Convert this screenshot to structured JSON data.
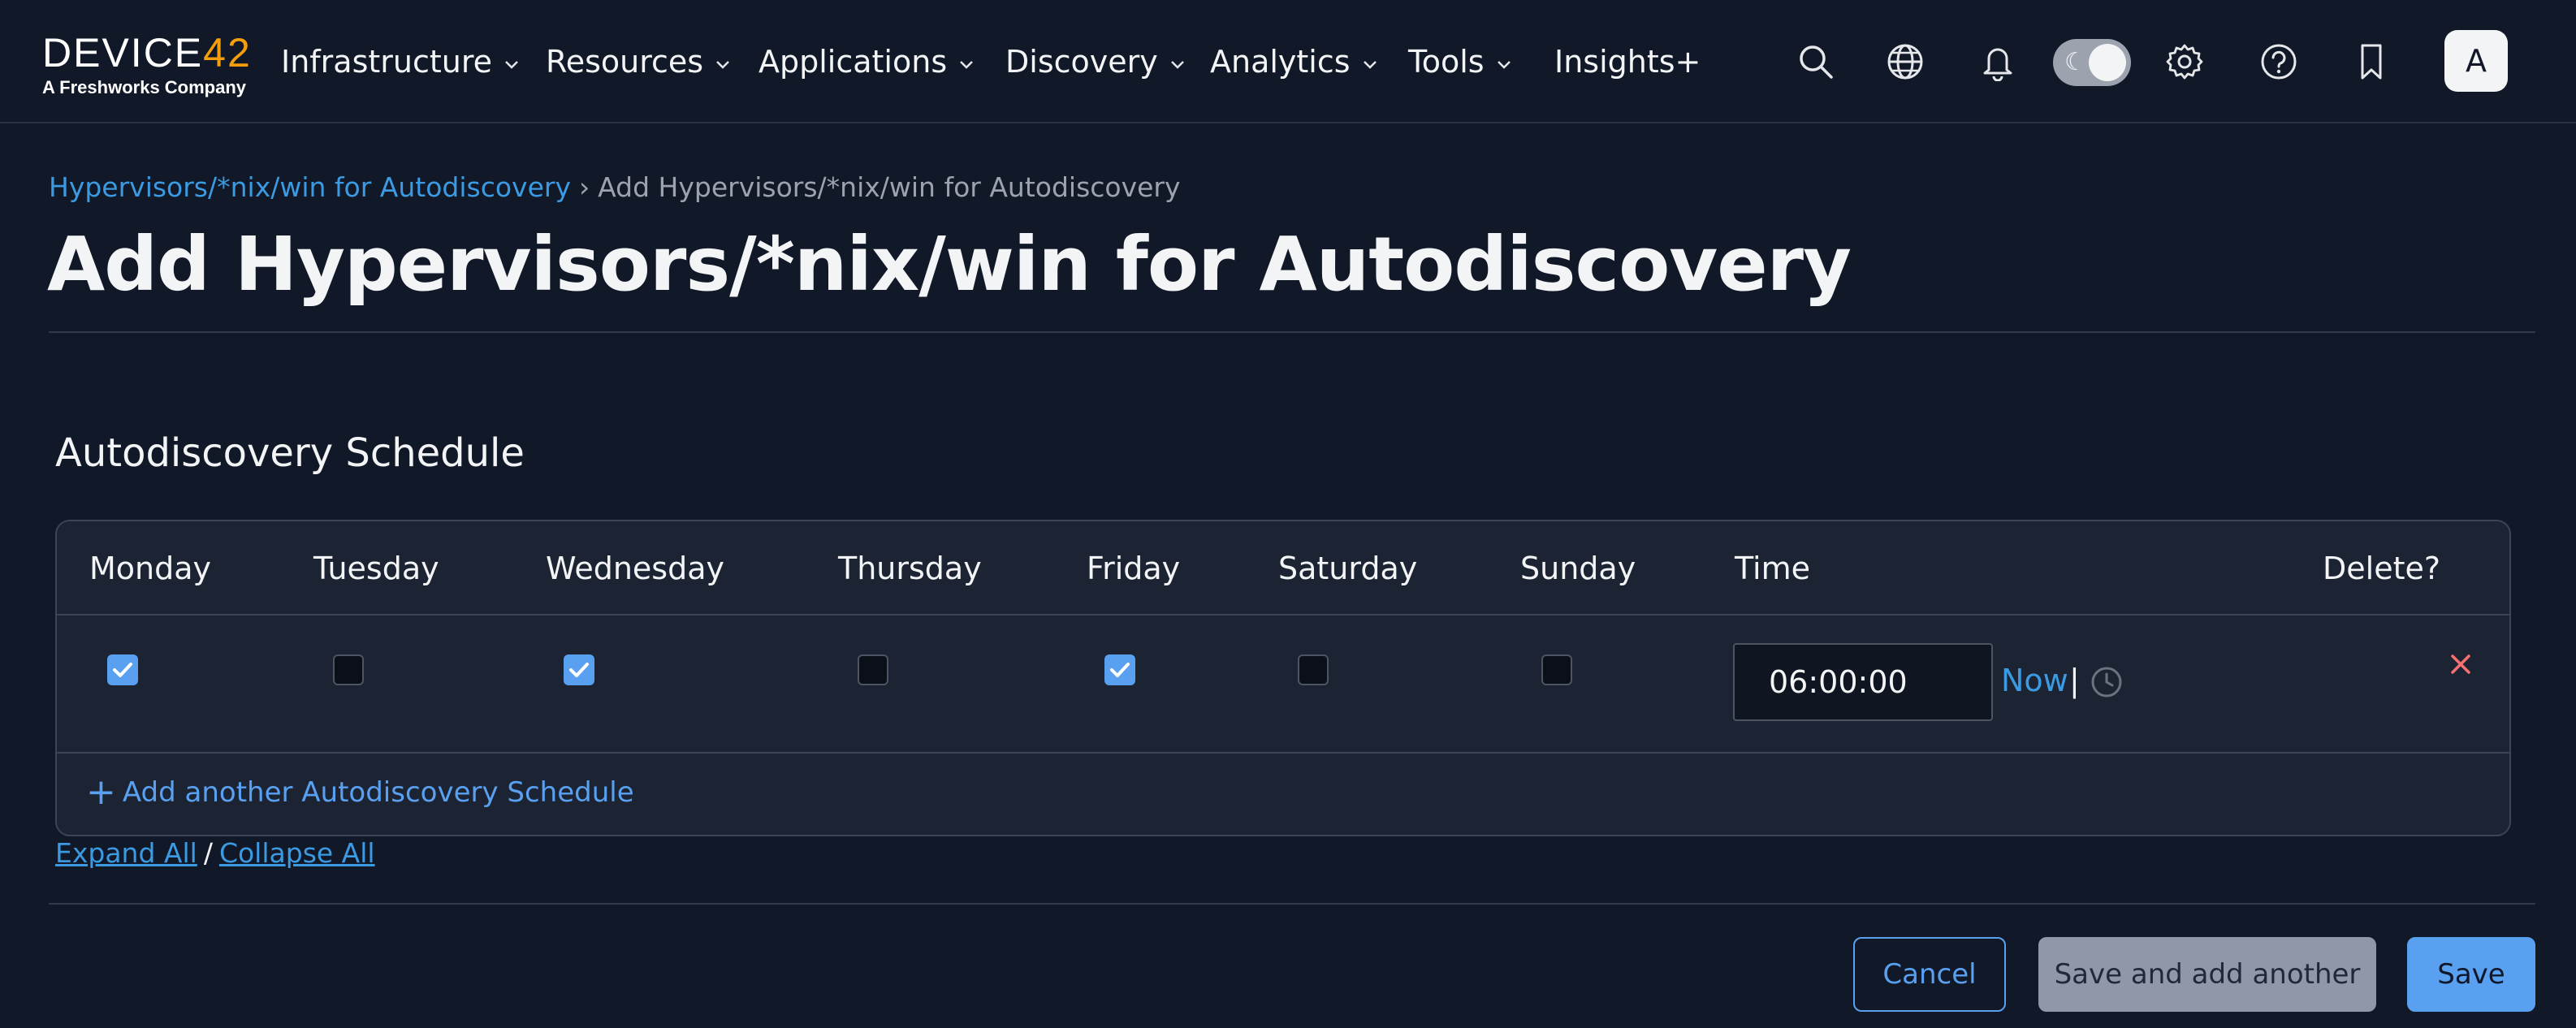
{
  "nav": {
    "logo_text_a": "DEVICE",
    "logo_text_b": "42",
    "logo_tagline": "A Freshworks Company",
    "menu": [
      {
        "label": "Infrastructure",
        "has_dropdown": true
      },
      {
        "label": "Resources",
        "has_dropdown": true
      },
      {
        "label": "Applications",
        "has_dropdown": true
      },
      {
        "label": "Discovery",
        "has_dropdown": true
      },
      {
        "label": "Analytics",
        "has_dropdown": true
      },
      {
        "label": "Tools",
        "has_dropdown": true
      },
      {
        "label": "Insights+",
        "has_dropdown": false
      }
    ],
    "icons": [
      "search-icon",
      "globe-icon",
      "bell-icon",
      "theme-toggle",
      "gear-icon",
      "help-icon",
      "bookmark-icon"
    ],
    "avatar_initial": "A"
  },
  "breadcrumb": {
    "parent": "Hypervisors/*nix/win for Autodiscovery",
    "separator": "›",
    "current": "Add Hypervisors/*nix/win for Autodiscovery"
  },
  "page_title": "Add Hypervisors/*nix/win for Autodiscovery",
  "section_title": "Autodiscovery Schedule",
  "schedule": {
    "columns": [
      "Monday",
      "Tuesday",
      "Wednesday",
      "Thursday",
      "Friday",
      "Saturday",
      "Sunday",
      "Time",
      "Delete?"
    ],
    "rows": [
      {
        "days": {
          "monday": true,
          "tuesday": false,
          "wednesday": true,
          "thursday": false,
          "friday": true,
          "saturday": false,
          "sunday": false
        },
        "time": "06:00:00",
        "now_label": "Now",
        "separator": "|"
      }
    ],
    "add_label": "Add another Autodiscovery Schedule"
  },
  "expand": {
    "expand_label": "Expand All",
    "separator": "/",
    "collapse_label": "Collapse All"
  },
  "buttons": {
    "cancel": "Cancel",
    "save_another": "Save and add another",
    "save": "Save"
  },
  "colors": {
    "background": "#111827",
    "accent": "#5aa0f0",
    "link": "#3b9ae1",
    "danger": "#f87171",
    "logo_accent": "#f59e0b"
  }
}
